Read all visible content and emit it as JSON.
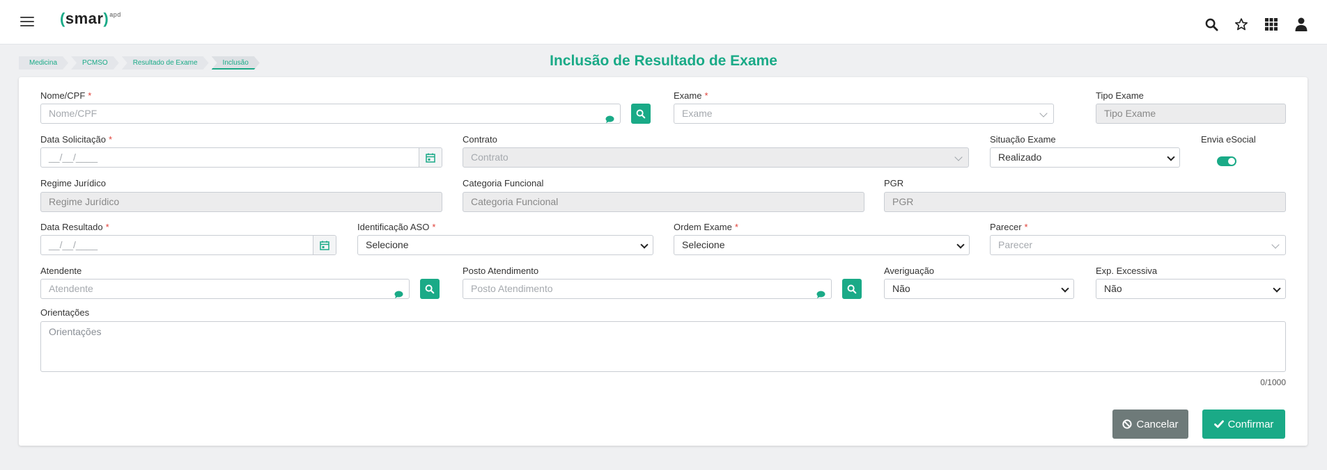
{
  "header": {
    "logo_text": "smar",
    "logo_suffix": "apd",
    "icons": [
      "menu-icon",
      "search-icon",
      "star-icon",
      "apps-grid-icon",
      "user-icon"
    ]
  },
  "breadcrumb": [
    "Medicina",
    "PCMSO",
    "Resultado de Exame",
    "Inclusão"
  ],
  "page_title": "Inclusão de Resultado de Exame",
  "colors": {
    "accent": "#1aaa87",
    "cancel": "#6e7a79",
    "required": "#e0423a"
  },
  "form": {
    "nome_cpf": {
      "label": "Nome/CPF",
      "required": "*",
      "placeholder": "Nome/CPF"
    },
    "exame": {
      "label": "Exame",
      "required": "*",
      "placeholder": "Exame"
    },
    "tipo_exame": {
      "label": "Tipo Exame",
      "placeholder": "Tipo Exame"
    },
    "data_solicitacao": {
      "label": "Data Solicitação",
      "required": "*",
      "placeholder": "__/__/____"
    },
    "contrato": {
      "label": "Contrato",
      "placeholder": "Contrato"
    },
    "situacao_exame": {
      "label": "Situação Exame",
      "value": "Realizado"
    },
    "envia_esocial": {
      "label": "Envia eSocial",
      "checked": true
    },
    "regime_juridico": {
      "label": "Regime Jurídico",
      "placeholder": "Regime Jurídico"
    },
    "categoria_funcional": {
      "label": "Categoria Funcional",
      "placeholder": "Categoria Funcional"
    },
    "pgr": {
      "label": "PGR",
      "placeholder": "PGR"
    },
    "data_resultado": {
      "label": "Data Resultado",
      "required": "*",
      "placeholder": "__/__/____"
    },
    "identificacao_aso": {
      "label": "Identificação ASO",
      "required": "*",
      "value": "Selecione"
    },
    "ordem_exame": {
      "label": "Ordem Exame",
      "required": "*",
      "value": "Selecione"
    },
    "parecer": {
      "label": "Parecer",
      "required": "*",
      "placeholder": "Parecer"
    },
    "atendente": {
      "label": "Atendente",
      "placeholder": "Atendente"
    },
    "posto_atendimento": {
      "label": "Posto Atendimento",
      "placeholder": "Posto Atendimento"
    },
    "averiguacao": {
      "label": "Averiguação",
      "value": "Não"
    },
    "exp_excessiva": {
      "label": "Exp. Excessiva",
      "value": "Não"
    },
    "orientacoes": {
      "label": "Orientações",
      "placeholder": "Orientações",
      "counter": "0/1000"
    }
  },
  "buttons": {
    "cancel": "Cancelar",
    "confirm": "Confirmar"
  }
}
